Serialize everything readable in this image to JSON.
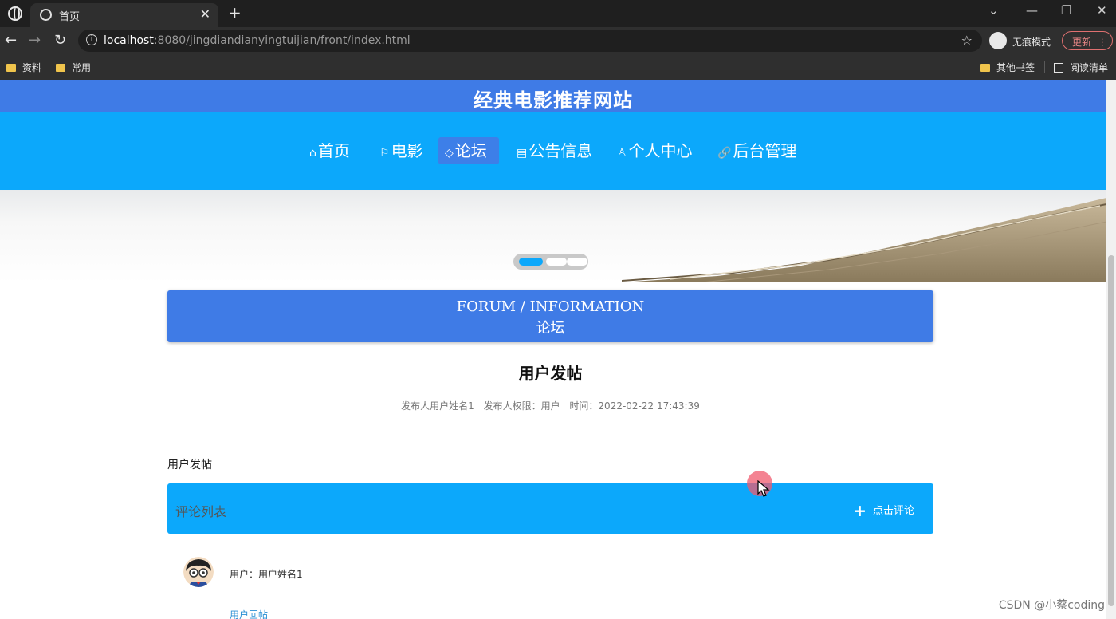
{
  "browser": {
    "tab_title": "首页",
    "url_host": "localhost",
    "url_rest": ":8080/jingdiandianyingtuijian/front/index.html",
    "incognito_label": "无痕模式",
    "update_label": "更新",
    "bookmarks": [
      "资料",
      "常用"
    ],
    "other_bookmarks": "其他书签",
    "reading_list": "阅读清单"
  },
  "site": {
    "title": "经典电影推荐网站",
    "nav": [
      {
        "label": "首页",
        "icon": "home-icon"
      },
      {
        "label": "电影",
        "icon": "flag-icon"
      },
      {
        "label": "论坛",
        "icon": "tag-icon"
      },
      {
        "label": "公告信息",
        "icon": "notice-icon"
      },
      {
        "label": "个人中心",
        "icon": "user-icon"
      },
      {
        "label": "后台管理",
        "icon": "link-icon"
      }
    ],
    "active_nav": "论坛"
  },
  "section": {
    "title_en": "FORUM / INFORMATION",
    "title_cn": "论坛"
  },
  "post": {
    "title": "用户发帖",
    "author": "发布人用户姓名1",
    "role": "发布人权限：用户",
    "time": "时间：2022-02-22 17:43:39",
    "content": "用户发帖"
  },
  "comments": {
    "header": "评论列表",
    "add_label": "点击评论",
    "items": [
      {
        "user": "用户：用户姓名1",
        "text": "用户回帖"
      }
    ]
  },
  "watermark": "CSDN @小蔡coding",
  "colors": {
    "header_blue": "#3f7be6",
    "nav_blue": "#0ca8fb"
  }
}
